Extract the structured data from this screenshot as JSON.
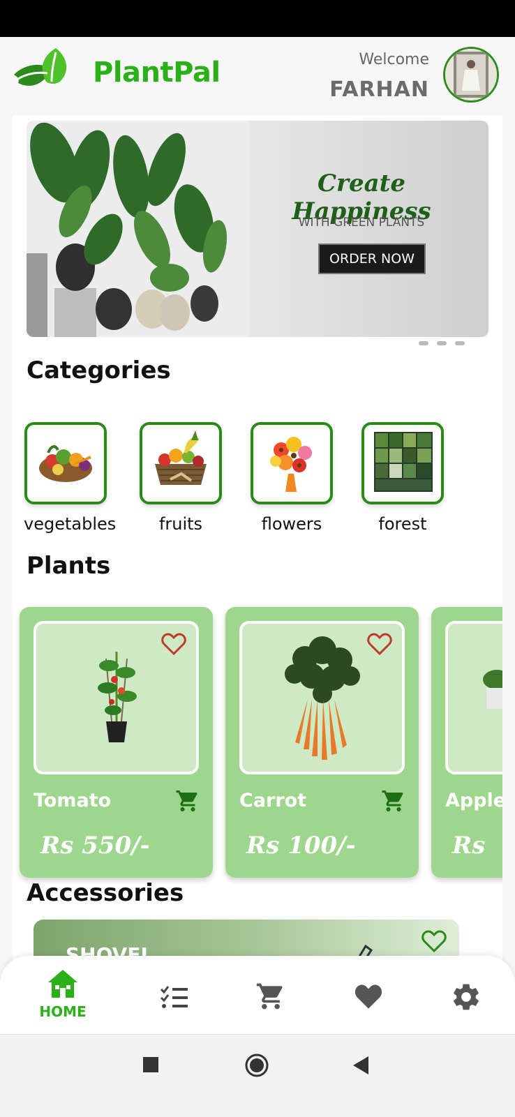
{
  "header": {
    "app_name": "PlantPal",
    "welcome_text": "Welcome",
    "user_name": "FARHAN"
  },
  "banner": {
    "title": "Create Happiness",
    "subtitle": "WITH GREEN PLANTS",
    "button_label": "ORDER NOW"
  },
  "categories": {
    "title": "Categories",
    "items": [
      {
        "label": "vegetables"
      },
      {
        "label": "fruits"
      },
      {
        "label": "flowers"
      },
      {
        "label": "forest"
      }
    ]
  },
  "plants": {
    "title": "Plants",
    "items": [
      {
        "name": "Tomato",
        "price": "Rs 550/-"
      },
      {
        "name": "Carrot",
        "price": "Rs 100/-"
      },
      {
        "name": "Apple",
        "price": "Rs"
      }
    ]
  },
  "accessories": {
    "title": "Accessories",
    "items": [
      {
        "name": "SHOVEL"
      }
    ]
  },
  "bottom_nav": {
    "items": [
      {
        "label": "HOME",
        "icon": "home-icon",
        "active": true
      },
      {
        "label": "",
        "icon": "checklist-icon"
      },
      {
        "label": "",
        "icon": "cart-icon"
      },
      {
        "label": "",
        "icon": "heart-icon"
      },
      {
        "label": "",
        "icon": "gear-icon"
      }
    ]
  },
  "colors": {
    "brand_green": "#2bb019",
    "card_green": "#9dd68c",
    "dark_green": "#2a8a18",
    "heart_red": "#c0392b"
  }
}
